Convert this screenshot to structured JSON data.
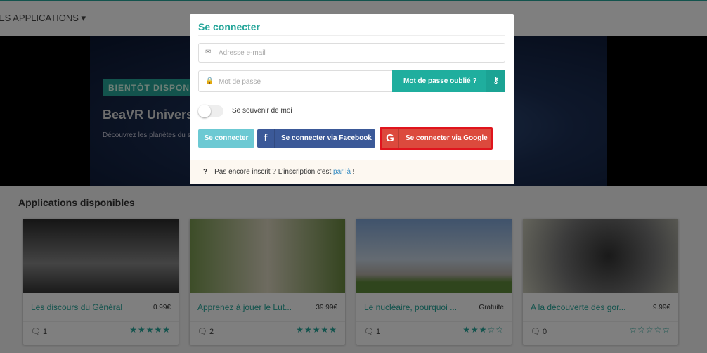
{
  "nav": {
    "apps_menu": "ES APPLICATIONS ▾"
  },
  "banner": {
    "badge": "BIENTÔT DISPONIBLE",
    "title": "BeaVR Universe",
    "description": "Découvrez les planètes du système solaire"
  },
  "section_title": "Applications disponibles",
  "cards": [
    {
      "title": "Les discours du Général",
      "price": "0.99€",
      "comments": "1",
      "rating": 5,
      "stars": "★★★★★"
    },
    {
      "title": "Apprenez à jouer le Lut...",
      "price": "39.99€",
      "comments": "2",
      "rating": 5,
      "stars": "★★★★★"
    },
    {
      "title": "Le nucléaire, pourquoi ...",
      "price": "Gratuite",
      "comments": "1",
      "rating": 3,
      "stars": "★★★☆☆"
    },
    {
      "title": "A la découverte des gor...",
      "price": "9.99€",
      "comments": "0",
      "rating": 0,
      "stars": "☆☆☆☆☆"
    }
  ],
  "modal": {
    "title": "Se connecter",
    "email_placeholder": "Adresse e-mail",
    "password_placeholder": "Mot de passe",
    "forgot_label": "Mot de passe oublié ?",
    "remember_label": "Se souvenir de moi",
    "remember_checked": false,
    "login_label": "Se connecter",
    "facebook_label": "Se connecter via Facebook",
    "google_label": "Se connecter via Google",
    "footer_text": "Pas encore inscrit ? L'inscription c'est ",
    "footer_link": "par là",
    "footer_end": " !",
    "footer_icon": "?"
  },
  "colors": {
    "accent": "#26a69a",
    "facebook": "#3b5998",
    "google": "#dc4a3d",
    "highlight": "#e0141d"
  }
}
